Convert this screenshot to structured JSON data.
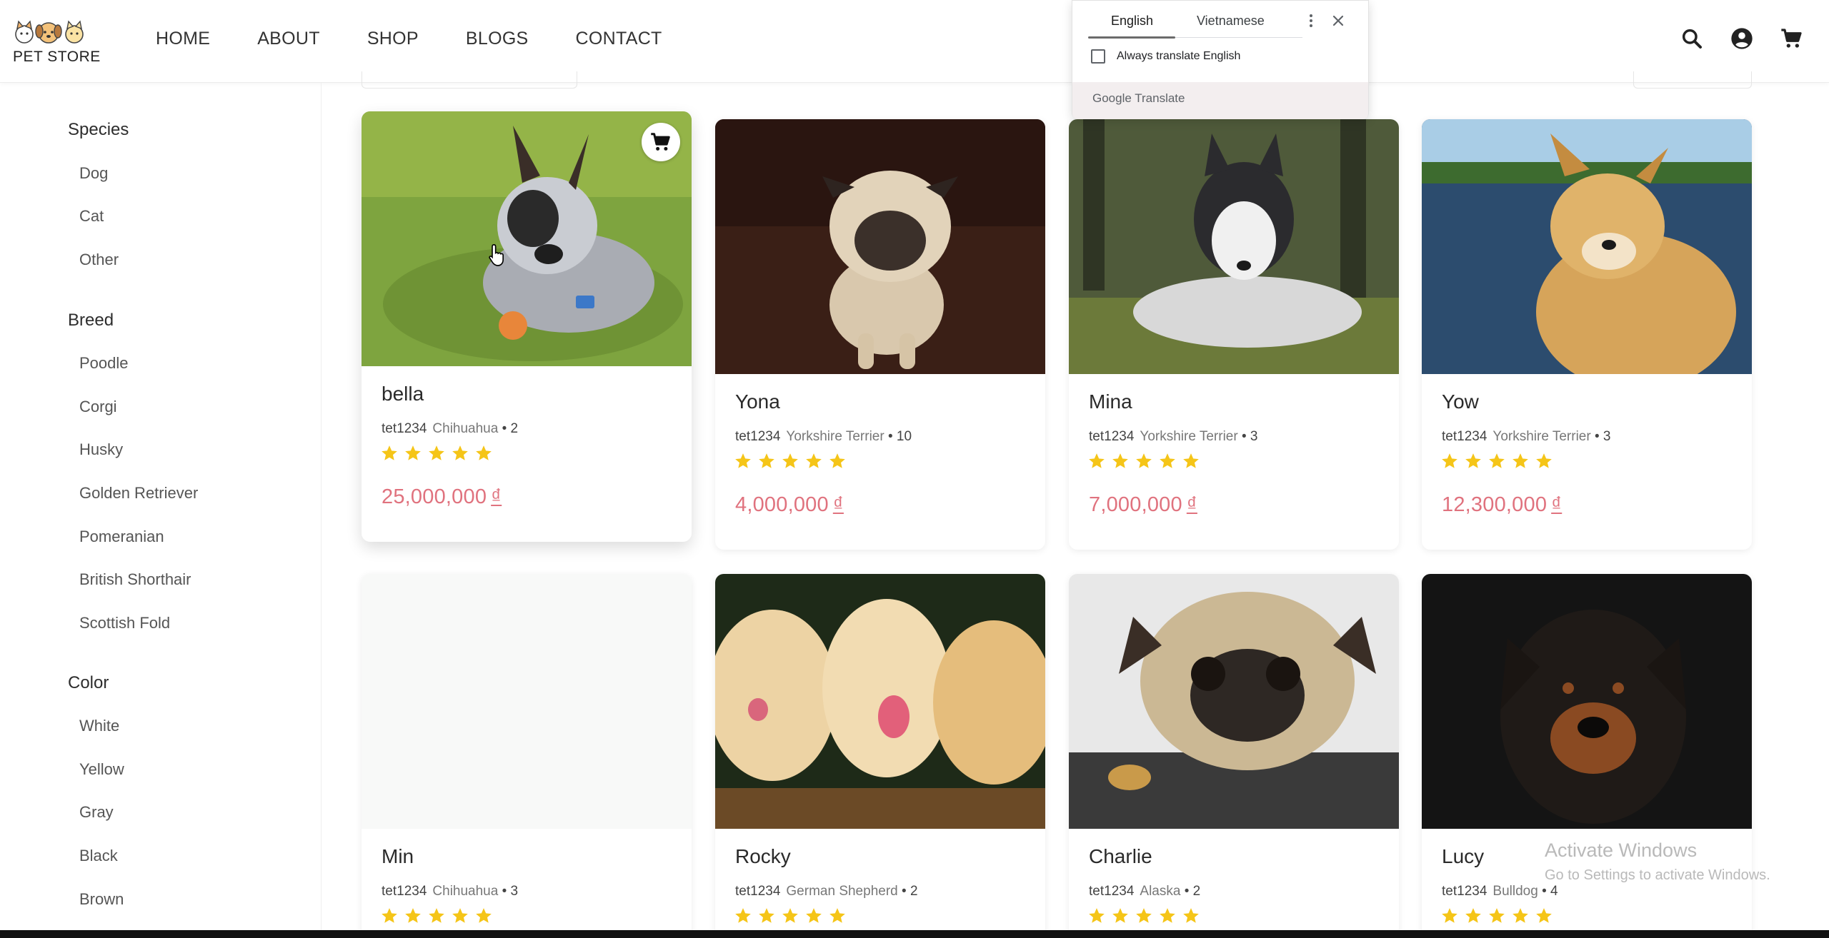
{
  "brand": {
    "logo_text": "PET STORE"
  },
  "nav": {
    "items": [
      "HOME",
      "ABOUT",
      "SHOP",
      "BLOGS",
      "CONTACT"
    ]
  },
  "header_icons": [
    "search-icon",
    "account-circle-icon",
    "cart-icon"
  ],
  "translate_popup": {
    "tabs": [
      "English",
      "Vietnamese"
    ],
    "active_tab": "English",
    "always_translate_label": "Always translate English",
    "always_translate_checked": false,
    "footer_google": "Google",
    "footer_translate": "Translate"
  },
  "sidebar": {
    "groups": [
      {
        "title": "Species",
        "items": [
          "Dog",
          "Cat",
          "Other"
        ]
      },
      {
        "title": "Breed",
        "items": [
          "Poodle",
          "Corgi",
          "Husky",
          "Golden Retriever",
          "Pomeranian",
          "British Shorthair",
          "Scottish Fold"
        ]
      },
      {
        "title": "Color",
        "items": [
          "White",
          "Yellow",
          "Gray",
          "Black",
          "Brown"
        ]
      }
    ]
  },
  "products": [
    {
      "name": "bella",
      "seller": "tet1234",
      "breed": "Chihuahua",
      "age": "2",
      "rating": 5,
      "price": "25,000,000",
      "currency": "₫",
      "hovered": true
    },
    {
      "name": "Yona",
      "seller": "tet1234",
      "breed": "Yorkshire Terrier",
      "age": "10",
      "rating": 5,
      "price": "4,000,000",
      "currency": "₫"
    },
    {
      "name": "Mina",
      "seller": "tet1234",
      "breed": "Yorkshire Terrier",
      "age": "3",
      "rating": 5,
      "price": "7,000,000",
      "currency": "₫"
    },
    {
      "name": "Yow",
      "seller": "tet1234",
      "breed": "Yorkshire Terrier",
      "age": "3",
      "rating": 5,
      "price": "12,300,000",
      "currency": "₫"
    },
    {
      "name": "Min",
      "seller": "tet1234",
      "breed": "Chihuahua",
      "age": "3",
      "rating": 5
    },
    {
      "name": "Rocky",
      "seller": "tet1234",
      "breed": "German Shepherd",
      "age": "2",
      "rating": 5
    },
    {
      "name": "Charlie",
      "seller": "tet1234",
      "breed": "Alaska",
      "age": "2",
      "rating": 5
    },
    {
      "name": "Lucy",
      "seller": "tet1234",
      "breed": "Bulldog",
      "age": "4",
      "rating": 5
    }
  ],
  "colors": {
    "accent_price": "#e0727e",
    "star": "#f5c518"
  },
  "watermark": {
    "line1": "Activate Windows",
    "line2": "Go to Settings to activate Windows."
  }
}
